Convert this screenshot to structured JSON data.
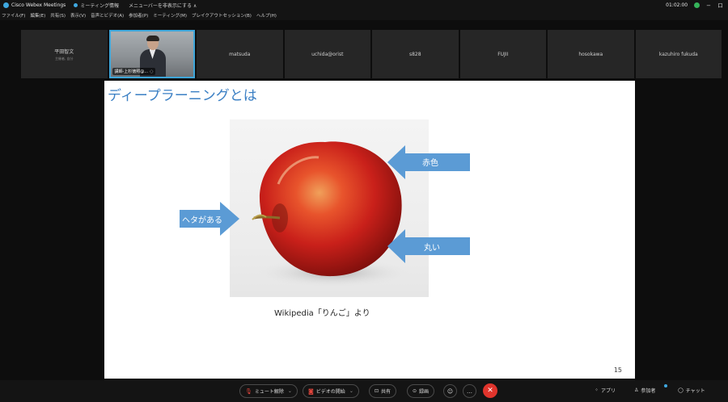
{
  "titlebar": {
    "app_name": "Cisco Webex Meetings",
    "meeting_info": "ミーティング情報",
    "hide_menu": "メニューバーを非表示にする ∧",
    "timer": "01:02:00",
    "minimize": "−",
    "restore": "ロ"
  },
  "menubar": {
    "items": [
      "ファイル(F)",
      "編集(E)",
      "共有(S)",
      "表示(V)",
      "音声とビデオ(A)",
      "参加者(P)",
      "ミーティング(M)",
      "ブレイクアウトセッション(B)",
      "ヘルプ(H)"
    ]
  },
  "participants": [
    {
      "name": "平田智文",
      "sub": "主催者, 自分"
    },
    {
      "name": "講師-上杉徳照@...",
      "active": true
    },
    {
      "name": "matsuda"
    },
    {
      "name": "uchida@orist"
    },
    {
      "name": "s828"
    },
    {
      "name": "FUJII"
    },
    {
      "name": "hosokawa"
    },
    {
      "name": "kazuhiro fukuda"
    }
  ],
  "slide": {
    "title": "ディープラーニングとは",
    "arrow_labels": {
      "red": "赤色",
      "stem": "ヘタがある",
      "round": "丸い"
    },
    "caption": "Wikipedia「りんご」より",
    "page_number": "15",
    "colors": {
      "title": "#3a7fc4",
      "arrow": "#5b9bd5",
      "apple": "#d42a1e"
    }
  },
  "controls": {
    "mute": "ミュート解除",
    "video": "ビデオの開始",
    "share": "共有",
    "record": "録画",
    "more": "…",
    "end": "✕",
    "apps": "アプリ",
    "participants": "参加者",
    "chat": "チャット"
  }
}
